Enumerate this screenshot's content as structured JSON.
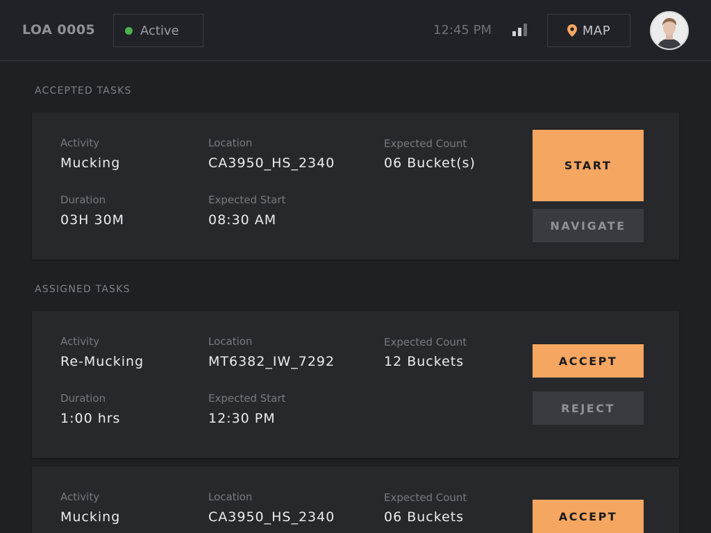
{
  "header": {
    "vehicle_id": "LOA 0005",
    "status_label": "Active",
    "status_color": "#4caf50",
    "time": "12:45 PM",
    "map_label": "MAP",
    "accent_color": "#f5a661"
  },
  "sections": {
    "accepted_title": "ACCEPTED TASKS",
    "assigned_title": "ASSIGNED TASKS"
  },
  "labels": {
    "activity": "Activity",
    "location": "Location",
    "expected_count": "Expected Count",
    "duration": "Duration",
    "expected_start": "Expected Start"
  },
  "accepted_task": {
    "activity": "Mucking",
    "location": "CA3950_HS_2340",
    "expected_count": "06 Bucket(s)",
    "duration": "03H 30M",
    "expected_start": "08:30 AM",
    "primary_action": "START",
    "secondary_action": "NAVIGATE"
  },
  "assigned_tasks": [
    {
      "activity": "Re-Mucking",
      "location": "MT6382_IW_7292",
      "expected_count": "12 Buckets",
      "duration": "1:00 hrs",
      "expected_start": "12:30 PM",
      "primary_action": "ACCEPT",
      "secondary_action": "REJECT"
    },
    {
      "activity": "Mucking",
      "location": "CA3950_HS_2340",
      "expected_count": "06 Buckets",
      "primary_action": "ACCEPT"
    }
  ]
}
